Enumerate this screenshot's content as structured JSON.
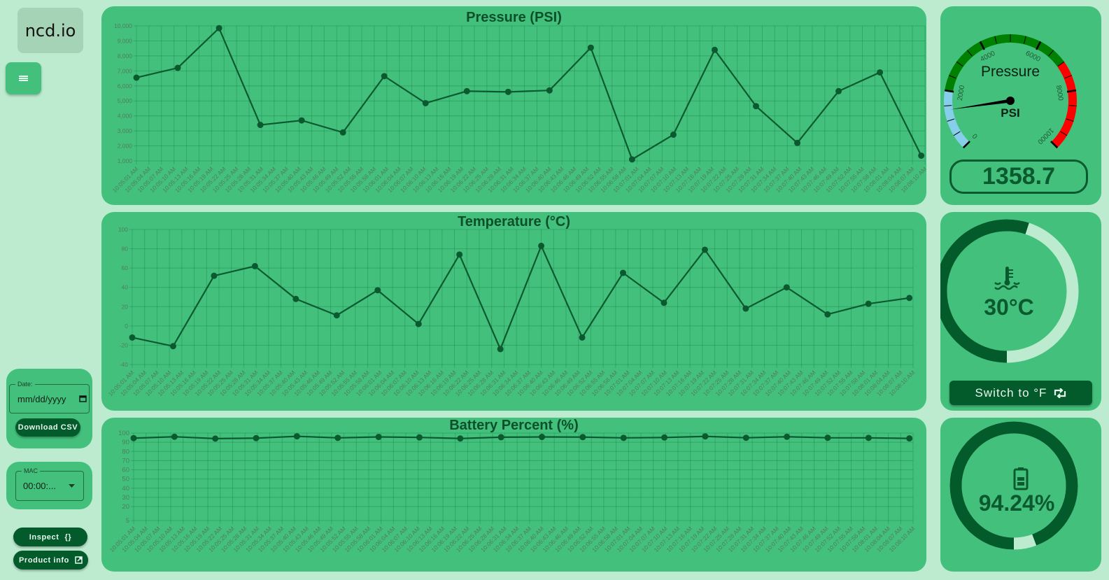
{
  "sidebar": {
    "logo_text": "ncd.io",
    "menu_icon": "hamburger-menu-icon",
    "date_label": "Date:",
    "date_placeholder": "mm/dd/yyyy",
    "download_label": "Download CSV",
    "mac_label": "MAC",
    "mac_value": "00:00:...",
    "inspect_label": "Inspect",
    "inspect_icon": "{}",
    "product_info_label": "Product info",
    "product_info_icon": "external-link-icon"
  },
  "colors": {
    "background": "#bdebd0",
    "panel": "#43c17c",
    "dark": "#035a2a",
    "line": "#0b5a2f",
    "gauge_blue": "#87ceeb",
    "gauge_green": "#008000",
    "gauge_red": "#ff0000"
  },
  "chart_data": [
    {
      "type": "line",
      "title": "Pressure (PSI)",
      "xlabel": "",
      "ylabel": "",
      "ylim": [
        1000,
        10000
      ],
      "yticks": [
        "1,000",
        "2,000",
        "3,000",
        "4,000",
        "5,000",
        "6,000",
        "7,000",
        "8,000",
        "9,000",
        "10,000"
      ],
      "grid": true,
      "x": [
        "10:05:01 AM",
        "10:05:04 AM",
        "10:05:07 AM",
        "10:05:10 AM",
        "10:05:13 AM",
        "10:05:16 AM",
        "10:05:19 AM",
        "10:05:22 AM",
        "10:05:25 AM",
        "10:05:28 AM",
        "10:05:31 AM",
        "10:05:34 AM",
        "10:05:37 AM",
        "10:05:40 AM",
        "10:05:43 AM",
        "10:05:46 AM",
        "10:05:49 AM",
        "10:05:52 AM",
        "10:05:55 AM",
        "10:05:58 AM",
        "10:06:01 AM",
        "10:06:04 AM",
        "10:06:07 AM",
        "10:06:10 AM",
        "10:06:13 AM",
        "10:06:16 AM",
        "10:06:19 AM",
        "10:06:22 AM",
        "10:06:25 AM",
        "10:06:28 AM",
        "10:06:31 AM",
        "10:06:34 AM",
        "10:06:37 AM",
        "10:06:40 AM",
        "10:06:43 AM",
        "10:06:46 AM",
        "10:06:49 AM",
        "10:06:52 AM",
        "10:06:55 AM",
        "10:06:58 AM",
        "10:07:01 AM",
        "10:07:04 AM",
        "10:07:07 AM",
        "10:07:10 AM",
        "10:07:13 AM",
        "10:07:16 AM",
        "10:07:19 AM",
        "10:07:22 AM",
        "10:07:25 AM",
        "10:07:28 AM",
        "10:07:31 AM",
        "10:07:34 AM",
        "10:07:37 AM",
        "10:07:40 AM",
        "10:07:43 AM",
        "10:07:46 AM",
        "10:07:49 AM",
        "10:07:52 AM",
        "10:07:55 AM",
        "10:07:58 AM",
        "10:08:01 AM",
        "10:08:04 AM",
        "10:08:07 AM",
        "10:08:10 AM"
      ],
      "points": [
        {
          "x": 0,
          "y": 6550
        },
        {
          "x": 3.3,
          "y": 7200
        },
        {
          "x": 6.6,
          "y": 9850
        },
        {
          "x": 9.9,
          "y": 3400
        },
        {
          "x": 13.2,
          "y": 3700
        },
        {
          "x": 16.5,
          "y": 2900
        },
        {
          "x": 19.8,
          "y": 6650
        },
        {
          "x": 23.1,
          "y": 4850
        },
        {
          "x": 26.4,
          "y": 5650
        },
        {
          "x": 29.7,
          "y": 5600
        },
        {
          "x": 33,
          "y": 5700
        },
        {
          "x": 36.3,
          "y": 8550
        },
        {
          "x": 39.6,
          "y": 1100
        },
        {
          "x": 42.9,
          "y": 2750
        },
        {
          "x": 46.2,
          "y": 8400
        },
        {
          "x": 49.5,
          "y": 4650
        },
        {
          "x": 52.8,
          "y": 2200
        },
        {
          "x": 56.1,
          "y": 5650
        },
        {
          "x": 59.4,
          "y": 6900
        },
        {
          "x": 62.7,
          "y": 1350
        }
      ]
    },
    {
      "type": "line",
      "title": "Temperature (°C)",
      "xlabel": "",
      "ylabel": "",
      "ylim": [
        -40,
        100
      ],
      "yticks": [
        "-40",
        "-20",
        "0",
        "20",
        "40",
        "60",
        "80",
        "100"
      ],
      "grid": true,
      "x_ref": "same as Pressure",
      "points": [
        {
          "x": 0,
          "y": -12
        },
        {
          "x": 3.3,
          "y": -21
        },
        {
          "x": 6.6,
          "y": 52
        },
        {
          "x": 9.9,
          "y": 62
        },
        {
          "x": 13.2,
          "y": 28
        },
        {
          "x": 16.5,
          "y": 11
        },
        {
          "x": 19.8,
          "y": 37
        },
        {
          "x": 23.1,
          "y": 2
        },
        {
          "x": 26.4,
          "y": 74
        },
        {
          "x": 29.7,
          "y": -24
        },
        {
          "x": 33,
          "y": 83
        },
        {
          "x": 36.3,
          "y": -12
        },
        {
          "x": 39.6,
          "y": 55
        },
        {
          "x": 42.9,
          "y": 24
        },
        {
          "x": 46.2,
          "y": 79
        },
        {
          "x": 49.5,
          "y": 18
        },
        {
          "x": 52.8,
          "y": 40
        },
        {
          "x": 56.1,
          "y": 12
        },
        {
          "x": 59.4,
          "y": 23
        },
        {
          "x": 62.7,
          "y": 29
        }
      ]
    },
    {
      "type": "line",
      "title": "Battery Percent (%)",
      "xlabel": "",
      "ylabel": "",
      "ylim": [
        5,
        100
      ],
      "yticks": [
        "5",
        "20",
        "30",
        "40",
        "50",
        "60",
        "70",
        "80",
        "90",
        "100"
      ],
      "grid": true,
      "x_ref": "same as Pressure",
      "points": [
        {
          "x": 0,
          "y": 94.5
        },
        {
          "x": 3.3,
          "y": 96
        },
        {
          "x": 6.6,
          "y": 94
        },
        {
          "x": 9.9,
          "y": 94.5
        },
        {
          "x": 13.2,
          "y": 96.5
        },
        {
          "x": 16.5,
          "y": 94.8
        },
        {
          "x": 19.8,
          "y": 95.8
        },
        {
          "x": 23.1,
          "y": 95.3
        },
        {
          "x": 26.4,
          "y": 94.1
        },
        {
          "x": 29.7,
          "y": 95.5
        },
        {
          "x": 33,
          "y": 95.8
        },
        {
          "x": 36.3,
          "y": 95.6
        },
        {
          "x": 39.6,
          "y": 94.8
        },
        {
          "x": 42.9,
          "y": 95.2
        },
        {
          "x": 46.2,
          "y": 96.4
        },
        {
          "x": 49.5,
          "y": 94.9
        },
        {
          "x": 52.8,
          "y": 96.0
        },
        {
          "x": 56.1,
          "y": 94.9
        },
        {
          "x": 59.4,
          "y": 94.8
        },
        {
          "x": 62.7,
          "y": 94.2
        }
      ]
    }
  ],
  "pressure_gauge": {
    "title": "Pressure",
    "unit": "PSI",
    "min": 0,
    "max": 10000,
    "value": 1358.7,
    "value_text": "1358.7",
    "major_labels": [
      "0",
      "2000",
      "4000",
      "6000",
      "8000",
      "10000"
    ],
    "bands": [
      {
        "from": 0,
        "to": 2000,
        "color": "#87ceeb"
      },
      {
        "from": 2000,
        "to": 7000,
        "color": "#008000"
      },
      {
        "from": 7000,
        "to": 10000,
        "color": "#ff0000"
      }
    ]
  },
  "temperature_gauge": {
    "value_text": "30°C",
    "fraction": 0.55,
    "icon": "coolant-temperature-icon",
    "switch_label": "Switch to °F",
    "switch_icon": "repeat-icon"
  },
  "battery_gauge": {
    "value_text": "94.24%",
    "fraction": 0.9424,
    "icon": "battery-icon"
  }
}
